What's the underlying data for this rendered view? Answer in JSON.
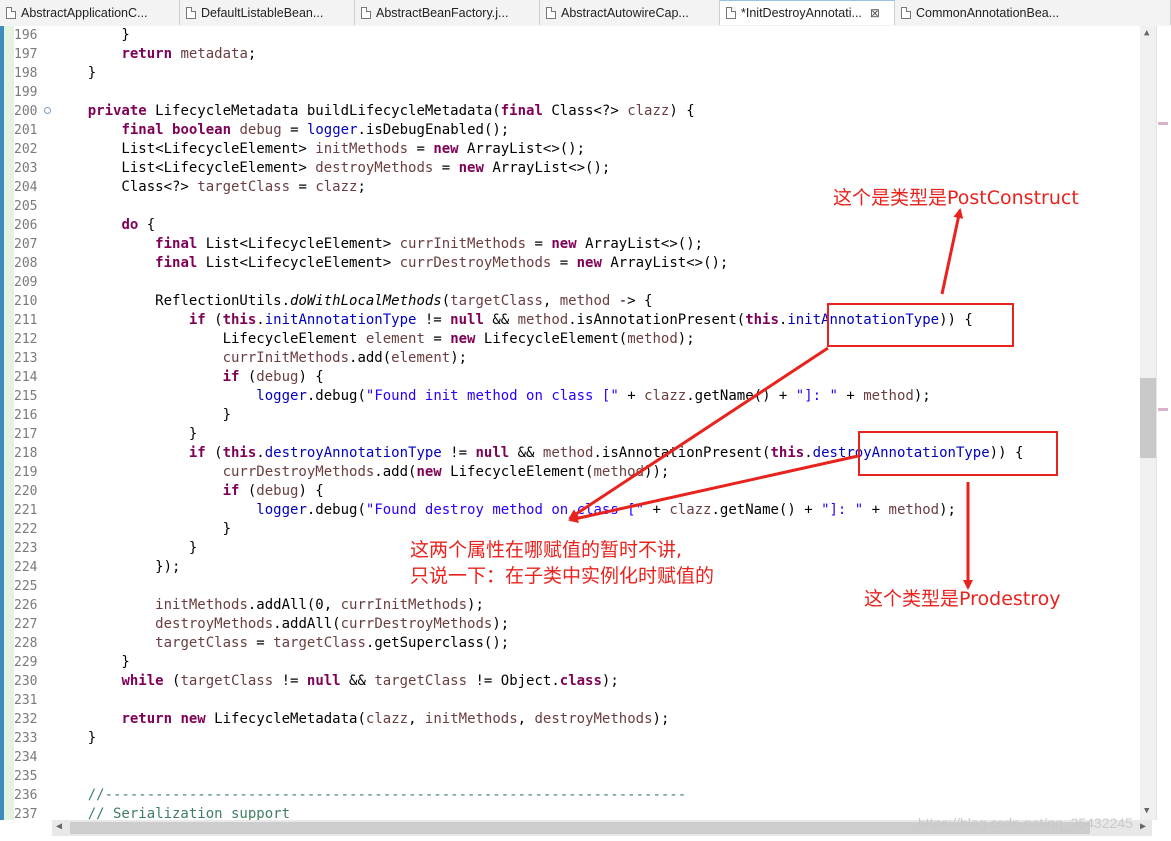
{
  "tabs": [
    {
      "label": "AbstractApplicationC...",
      "active": false,
      "width": 180
    },
    {
      "label": "DefaultListableBean...",
      "active": false,
      "width": 175
    },
    {
      "label": "AbstractBeanFactory.j...",
      "active": false,
      "width": 185
    },
    {
      "label": "AbstractAutowireCap...",
      "active": false,
      "width": 180
    },
    {
      "label": "*InitDestroyAnnotati...",
      "active": true,
      "close": "⊠",
      "width": 175
    },
    {
      "label": "CommonAnnotationBea...",
      "active": false,
      "width": 276
    }
  ],
  "code_lines": [
    {
      "n": "196",
      "html": "        }"
    },
    {
      "n": "197",
      "html": "        <span class='kw'>return</span> <span class='vr'>metadata</span>;"
    },
    {
      "n": "198",
      "html": "    }"
    },
    {
      "n": "199",
      "html": ""
    },
    {
      "n": "200",
      "fold": true,
      "html": "    <span class='kw'>private</span> LifecycleMetadata buildLifecycleMetadata(<span class='kw'>final</span> Class&lt;?&gt; <span class='vr'>clazz</span>) {"
    },
    {
      "n": "201",
      "html": "        <span class='kw'>final</span> <span class='kw'>boolean</span> <span class='vr'>debug</span> = <span class='fd'>logger</span>.isDebugEnabled();"
    },
    {
      "n": "202",
      "html": "        List&lt;LifecycleElement&gt; <span class='vr'>initMethods</span> = <span class='kw'>new</span> ArrayList&lt;&gt;();"
    },
    {
      "n": "203",
      "html": "        List&lt;LifecycleElement&gt; <span class='vr'>destroyMethods</span> = <span class='kw'>new</span> ArrayList&lt;&gt;();"
    },
    {
      "n": "204",
      "html": "        Class&lt;?&gt; <span class='vr'>targetClass</span> = <span class='vr'>clazz</span>;"
    },
    {
      "n": "205",
      "html": ""
    },
    {
      "n": "206",
      "html": "        <span class='kw'>do</span> {"
    },
    {
      "n": "207",
      "html": "            <span class='kw'>final</span> List&lt;LifecycleElement&gt; <span class='vr'>currInitMethods</span> = <span class='kw'>new</span> ArrayList&lt;&gt;();"
    },
    {
      "n": "208",
      "html": "            <span class='kw'>final</span> List&lt;LifecycleElement&gt; <span class='vr'>currDestroyMethods</span> = <span class='kw'>new</span> ArrayList&lt;&gt;();"
    },
    {
      "n": "209",
      "html": ""
    },
    {
      "n": "210",
      "html": "            ReflectionUtils.<span class='it'>doWithLocalMethods</span>(<span class='vr'>targetClass</span>, <span class='vr'>method</span> -&gt; {"
    },
    {
      "n": "211",
      "html": "                <span class='kw'>if</span> (<span class='kw'>this</span>.<span class='fd'>initAnnotationType</span> != <span class='kw'>null</span> &amp;&amp; <span class='vr'>method</span>.isAnnotationPresent(<span class='kw'>this</span>.<span class='fd'>initAnnotationType</span>)) {"
    },
    {
      "n": "212",
      "html": "                    LifecycleElement <span class='vr'>element</span> = <span class='kw'>new</span> LifecycleElement(<span class='vr'>method</span>);"
    },
    {
      "n": "213",
      "html": "                    <span class='vr'>currInitMethods</span>.add(<span class='vr'>element</span>);"
    },
    {
      "n": "214",
      "html": "                    <span class='kw'>if</span> (<span class='vr'>debug</span>) {"
    },
    {
      "n": "215",
      "html": "                        <span class='fd'>logger</span>.debug(<span class='st'>\"Found init method on class [\"</span> + <span class='vr'>clazz</span>.getName() + <span class='st'>\"]: \"</span> + <span class='vr'>method</span>);"
    },
    {
      "n": "216",
      "html": "                    }"
    },
    {
      "n": "217",
      "html": "                }"
    },
    {
      "n": "218",
      "html": "                <span class='kw'>if</span> (<span class='kw'>this</span>.<span class='fd'>destroyAnnotationType</span> != <span class='kw'>null</span> &amp;&amp; <span class='vr'>method</span>.isAnnotationPresent(<span class='kw'>this</span>.<span class='fd'>destroyAnnotationType</span>)) {"
    },
    {
      "n": "219",
      "html": "                    <span class='vr'>currDestroyMethods</span>.add(<span class='kw'>new</span> LifecycleElement(<span class='vr'>method</span>));"
    },
    {
      "n": "220",
      "html": "                    <span class='kw'>if</span> (<span class='vr'>debug</span>) {"
    },
    {
      "n": "221",
      "html": "                        <span class='fd'>logger</span>.debug(<span class='st'>\"Found destroy method on class [\"</span> + <span class='vr'>clazz</span>.getName() + <span class='st'>\"]: \"</span> + <span class='vr'>method</span>);"
    },
    {
      "n": "222",
      "html": "                    }"
    },
    {
      "n": "223",
      "html": "                }"
    },
    {
      "n": "224",
      "html": "            });"
    },
    {
      "n": "225",
      "html": ""
    },
    {
      "n": "226",
      "html": "            <span class='vr'>initMethods</span>.addAll(0, <span class='vr'>currInitMethods</span>);"
    },
    {
      "n": "227",
      "html": "            <span class='vr'>destroyMethods</span>.addAll(<span class='vr'>currDestroyMethods</span>);"
    },
    {
      "n": "228",
      "html": "            <span class='vr'>targetClass</span> = <span class='vr'>targetClass</span>.getSuperclass();"
    },
    {
      "n": "229",
      "html": "        }"
    },
    {
      "n": "230",
      "html": "        <span class='kw'>while</span> (<span class='vr'>targetClass</span> != <span class='kw'>null</span> &amp;&amp; <span class='vr'>targetClass</span> != Object.<span class='kw'>class</span>);"
    },
    {
      "n": "231",
      "html": ""
    },
    {
      "n": "232",
      "html": "        <span class='kw'>return</span> <span class='kw'>new</span> LifecycleMetadata(<span class='vr'>clazz</span>, <span class='vr'>initMethods</span>, <span class='vr'>destroyMethods</span>);"
    },
    {
      "n": "233",
      "html": "    }"
    },
    {
      "n": "234",
      "html": ""
    },
    {
      "n": "235",
      "html": ""
    },
    {
      "n": "236",
      "html": "    <span class='cm'>//---------------------------------------------------------------------</span>"
    },
    {
      "n": "237",
      "html": "    <span class='cm'>// Serialization support</span>"
    }
  ],
  "annotations": {
    "note_postconstruct": "这个是类型是PostConstruct",
    "note_middle_line1": "这两个属性在哪赋值的暂时不讲,",
    "note_middle_line2": "只说一下：在子类中实例化时赋值的",
    "note_prodestroy": "这个类型是Prodestroy"
  },
  "watermark": "https://blog.csdn.net/qq_25432245",
  "colors": {
    "keyword": "#7f0055",
    "field": "#0000c0",
    "variable": "#6a3e3e",
    "string": "#2a00ff",
    "comment": "#3f7f5f",
    "annotation": "#e8231e"
  }
}
